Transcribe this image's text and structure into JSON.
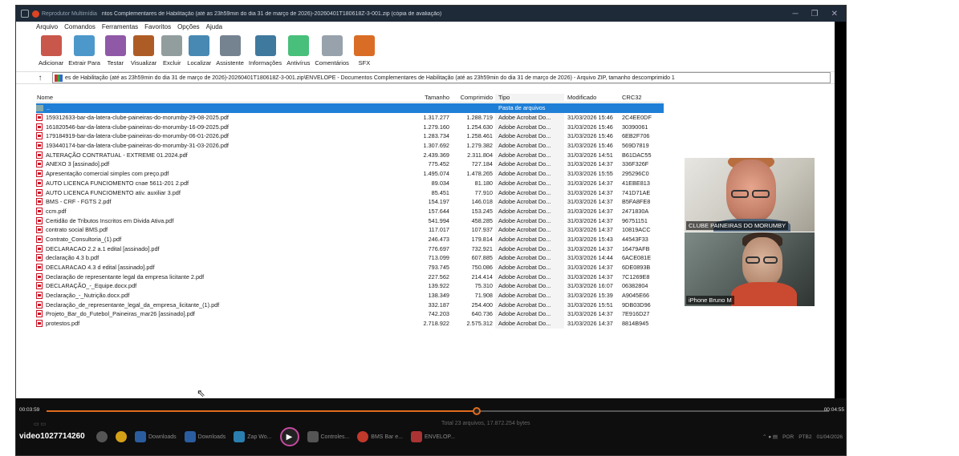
{
  "titlebar": {
    "player_label": "Reprodutor Multimídia",
    "title": "ntos Complementares de Habilitação (até as 23h59min do dia 31 de março de 2026)-20260401T180618Z-3-001.zip (cópia de avaliação)"
  },
  "menu": [
    "Arquivo",
    "Comandos",
    "Ferramentas",
    "Favoritos",
    "Opções",
    "Ajuda"
  ],
  "toolbar": [
    {
      "label": "Adicionar",
      "icon": "add-archive-icon",
      "color": "#c0392b"
    },
    {
      "label": "Extrair Para",
      "icon": "extract-folder-icon",
      "color": "#2e86c1"
    },
    {
      "label": "Testar",
      "icon": "test-icon",
      "color": "#7d3c98"
    },
    {
      "label": "Visualizar",
      "icon": "view-book-icon",
      "color": "#a04000"
    },
    {
      "label": "Excluir",
      "icon": "trash-icon",
      "color": "#7f8c8d"
    },
    {
      "label": "Localizar",
      "icon": "magnifier-icon",
      "color": "#2874a6"
    },
    {
      "label": "Assistente",
      "icon": "wand-icon",
      "color": "#5d6d7e"
    },
    {
      "label": "Informações",
      "icon": "info-icon",
      "color": "#1f618d"
    },
    {
      "label": "Antivírus",
      "icon": "antivirus-icon",
      "color": "#28b463"
    },
    {
      "label": "Comentários",
      "icon": "comments-icon",
      "color": "#85929e"
    },
    {
      "label": "SFX",
      "icon": "sfx-icon",
      "color": "#d35400"
    }
  ],
  "address": {
    "path": "es de Habilitação (até as 23h59min do dia 31 de março de 2026)-20260401T180618Z-3-001.zip\\ENVELOPE - Documentos Complementares de Habilitação (até as 23h59min do dia 31 de março de 2026) - Arquivo ZIP, tamanho descomprimido 1"
  },
  "columns": {
    "name": "Nome",
    "size": "Tamanho",
    "compressed": "Comprimido",
    "type": "Tipo",
    "modified": "Modificado",
    "crc": "CRC32"
  },
  "parent_row": {
    "name": "..",
    "type": "Pasta de arquivos"
  },
  "files": [
    {
      "name": "159312633-bar-da-latera-clube-paineiras-do-morumby-29-08-2025.pdf",
      "size": "1.317.277",
      "comp": "1.288.719",
      "type": "Adobe Acrobat Do...",
      "mod": "31/03/2026 15:46",
      "crc": "2C4EE0DF"
    },
    {
      "name": "161820546-bar-da-latera-clube-paineiras-do-morumby-16-09-2025.pdf",
      "size": "1.279.160",
      "comp": "1.254.630",
      "type": "Adobe Acrobat Do...",
      "mod": "31/03/2026 15:46",
      "crc": "30390061"
    },
    {
      "name": "179184919-bar-da-latera-clube-paineiras-do-morumby-06-01-2026.pdf",
      "size": "1.283.734",
      "comp": "1.258.461",
      "type": "Adobe Acrobat Do...",
      "mod": "31/03/2026 15:46",
      "crc": "6EB2F706"
    },
    {
      "name": "193440174-bar-da-latera-clube-paineiras-do-morumby-31-03-2026.pdf",
      "size": "1.307.692",
      "comp": "1.279.382",
      "type": "Adobe Acrobat Do...",
      "mod": "31/03/2026 15:46",
      "crc": "569D7819"
    },
    {
      "name": "ALTERAÇÃO CONTRATUAL - EXTREME 01.2024.pdf",
      "size": "2.439.369",
      "comp": "2.311.804",
      "type": "Adobe Acrobat Do...",
      "mod": "31/03/2026 14:51",
      "crc": "B61DAC55"
    },
    {
      "name": "ANEXO 3 [assinado].pdf",
      "size": "775.452",
      "comp": "727.184",
      "type": "Adobe Acrobat Do...",
      "mod": "31/03/2026 14:37",
      "crc": "336F326F"
    },
    {
      "name": "Apresentação comercial simples com preço.pdf",
      "size": "1.495.074",
      "comp": "1.478.265",
      "type": "Adobe Acrobat Do...",
      "mod": "31/03/2026 15:55",
      "crc": "295296C0"
    },
    {
      "name": "AUTO LICENCA FUNCIOMENTO cnae 5611-201 2.pdf",
      "size": "89.034",
      "comp": "81.180",
      "type": "Adobe Acrobat Do...",
      "mod": "31/03/2026 14:37",
      "crc": "41EBE813"
    },
    {
      "name": "AUTO LICENCA FUNCIOMENTO ativ. auxiliar 3.pdf",
      "size": "85.451",
      "comp": "77.910",
      "type": "Adobe Acrobat Do...",
      "mod": "31/03/2026 14:37",
      "crc": "741D71AE"
    },
    {
      "name": "BMS - CRF - FGTS 2.pdf",
      "size": "154.197",
      "comp": "146.018",
      "type": "Adobe Acrobat Do...",
      "mod": "31/03/2026 14:37",
      "crc": "B5FA8FE8"
    },
    {
      "name": "ccm.pdf",
      "size": "157.644",
      "comp": "153.245",
      "type": "Adobe Acrobat Do...",
      "mod": "31/03/2026 14:37",
      "crc": "2471830A"
    },
    {
      "name": "Certidão de Tributos Inscritos em Divida Ativa.pdf",
      "size": "541.994",
      "comp": "458.285",
      "type": "Adobe Acrobat Do...",
      "mod": "31/03/2026 14:37",
      "crc": "96751151"
    },
    {
      "name": "contrato social BMS.pdf",
      "size": "117.017",
      "comp": "107.937",
      "type": "Adobe Acrobat Do...",
      "mod": "31/03/2026 14:37",
      "crc": "10819ACC"
    },
    {
      "name": "Contrato_Consultoria_(1).pdf",
      "size": "246.473",
      "comp": "179.814",
      "type": "Adobe Acrobat Do...",
      "mod": "31/03/2026 15:43",
      "crc": "44543F33"
    },
    {
      "name": "DECLARACAO 2.2 a.1 edital [assinado].pdf",
      "size": "776.697",
      "comp": "732.921",
      "type": "Adobe Acrobat Do...",
      "mod": "31/03/2026 14:37",
      "crc": "16479AFB"
    },
    {
      "name": "declaração 4.3 b.pdf",
      "size": "713.099",
      "comp": "607.885",
      "type": "Adobe Acrobat Do...",
      "mod": "31/03/2026 14:44",
      "crc": "6ACE081E"
    },
    {
      "name": "DECLARACAO 4.3 d edital [assinado].pdf",
      "size": "793.745",
      "comp": "750.086",
      "type": "Adobe Acrobat Do...",
      "mod": "31/03/2026 14:37",
      "crc": "6DE0893B"
    },
    {
      "name": "Declaração de representante legal da empresa licitante 2.pdf",
      "size": "227.562",
      "comp": "214.414",
      "type": "Adobe Acrobat Do...",
      "mod": "31/03/2026 14:37",
      "crc": "7C1269E8"
    },
    {
      "name": "DECLARAÇÃO_-_Equipe.docx.pdf",
      "size": "139.922",
      "comp": "75.310",
      "type": "Adobe Acrobat Do...",
      "mod": "31/03/2026 16:07",
      "crc": "06382804"
    },
    {
      "name": "Declaração_-_Nutrição.docx.pdf",
      "size": "138.349",
      "comp": "71.908",
      "type": "Adobe Acrobat Do...",
      "mod": "31/03/2026 15:39",
      "crc": "A9045E66"
    },
    {
      "name": "Declaração_de_representante_legal_da_empresa_licitante_(1).pdf",
      "size": "332.187",
      "comp": "254.400",
      "type": "Adobe Acrobat Do...",
      "mod": "31/03/2026 15:51",
      "crc": "9DB03D96"
    },
    {
      "name": "Projeto_Bar_do_Futebol_Paineiras_mar26 [assinado].pdf",
      "size": "742.203",
      "comp": "640.736",
      "type": "Adobe Acrobat Do...",
      "mod": "31/03/2026 14:37",
      "crc": "7E916D27"
    },
    {
      "name": "protestos.pdf",
      "size": "2.718.922",
      "comp": "2.575.312",
      "type": "Adobe Acrobat Do...",
      "mod": "31/03/2026 14:37",
      "crc": "8814B945"
    }
  ],
  "participants": [
    {
      "label": "CLUBE PAINEIRAS DO MORUMBY"
    },
    {
      "label": "iPhone Bruno M"
    }
  ],
  "player": {
    "elapsed": "00:03:59",
    "total": "00:04:55",
    "progress_fraction": 0.55,
    "summary": "Total 23 arquivos, 17.872.254 bytes",
    "video_name": "video1027714260"
  },
  "taskbar": {
    "items": [
      "Downloads",
      "Downloads",
      "Zap Wo...",
      "Controles...",
      "BMS Bar e...",
      "ENVELOP..."
    ],
    "tray_lang": "POR",
    "tray_lang2": "PTB2",
    "tray_date": "01/04/2026"
  }
}
